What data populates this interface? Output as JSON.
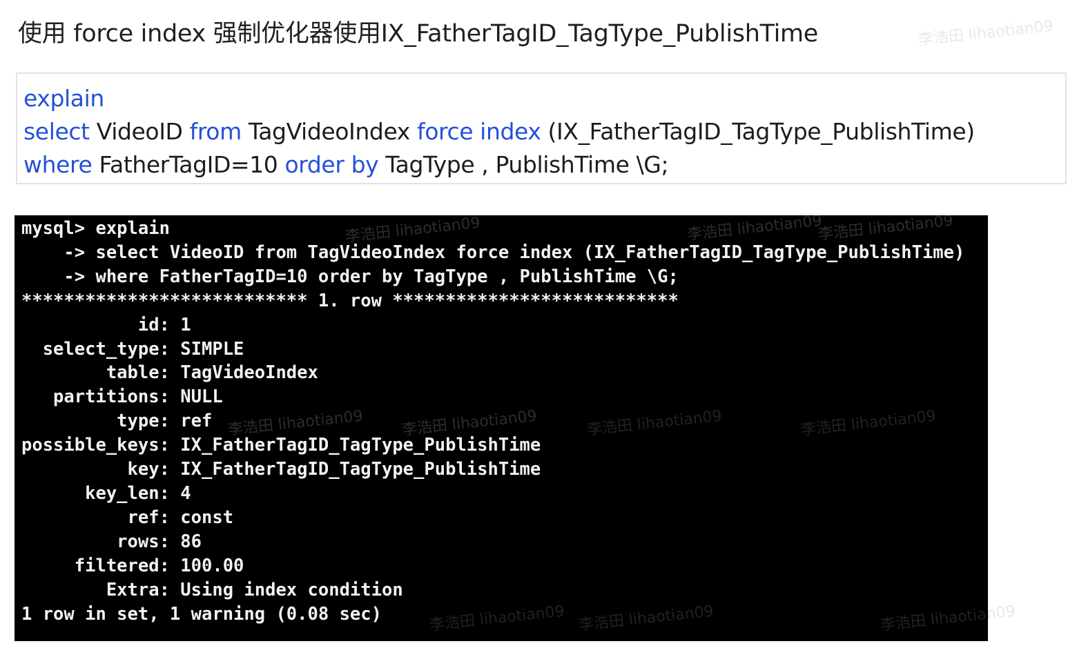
{
  "heading": "使用 force index 强制优化器使用IX_FatherTagID_TagType_PublishTime",
  "sql": {
    "line1": {
      "kw1": "explain"
    },
    "line2": {
      "kw_select": "select",
      "t1": " VideoID ",
      "kw_from": "from",
      "t2": " TagVideoIndex ",
      "kw_force": "force index",
      "t3": " (IX_FatherTagID_TagType_PublishTime)"
    },
    "line3": {
      "kw_where": "where",
      "t1": " FatherTagID=10 ",
      "kw_order": "order by",
      "t2": " TagType , PublishTime \\G;"
    }
  },
  "terminal": {
    "lines": [
      "mysql> explain",
      "    -> select VideoID from TagVideoIndex force index (IX_FatherTagID_TagType_PublishTime)",
      "    -> where FatherTagID=10 order by TagType , PublishTime \\G;",
      "*************************** 1. row ***************************",
      "           id: 1",
      "  select_type: SIMPLE",
      "        table: TagVideoIndex",
      "   partitions: NULL",
      "         type: ref",
      "possible_keys: IX_FatherTagID_TagType_PublishTime",
      "          key: IX_FatherTagID_TagType_PublishTime",
      "      key_len: 4",
      "          ref: const",
      "         rows: 86",
      "     filtered: 100.00",
      "        Extra: Using index condition",
      "1 row in set, 1 warning (0.08 sec)"
    ]
  },
  "watermark": {
    "text": "李浩田 lihaotian09"
  }
}
